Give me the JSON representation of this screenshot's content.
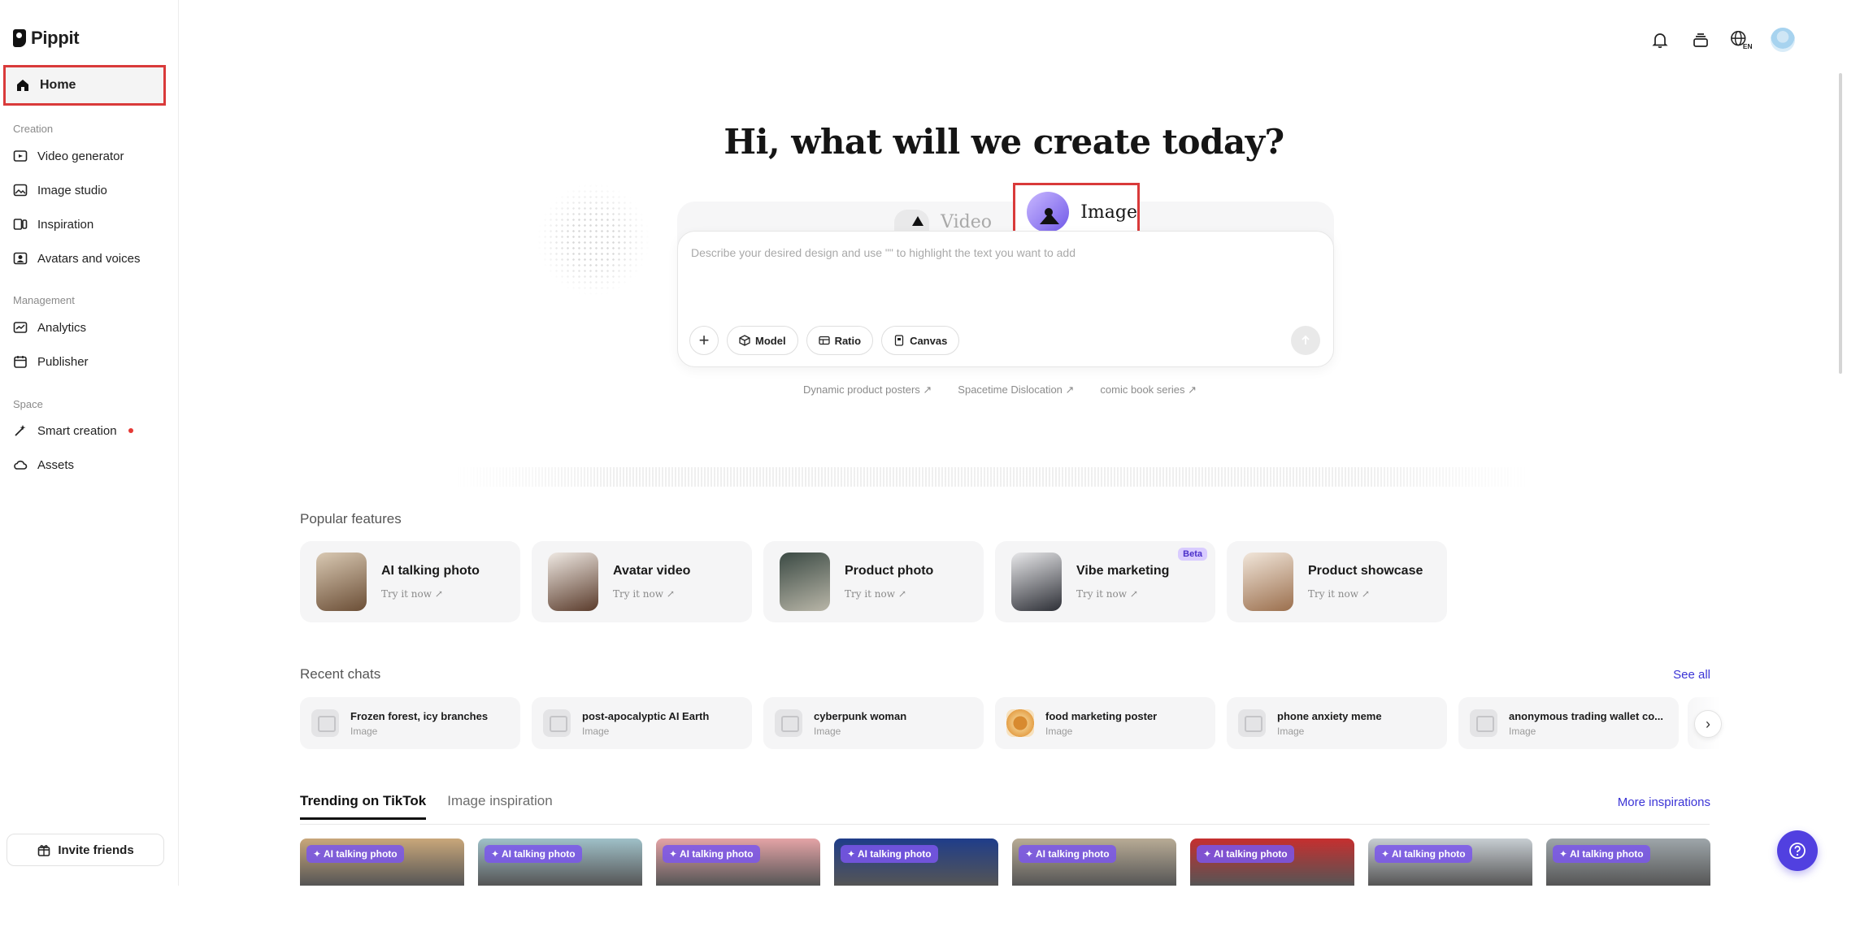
{
  "app": {
    "logo_text": "Pippit"
  },
  "sidebar": {
    "home_label": "Home",
    "sections": {
      "creation": "Creation",
      "management": "Management",
      "space": "Space"
    },
    "creation_items": [
      {
        "label": "Video generator",
        "icon": "video-plus-icon"
      },
      {
        "label": "Image studio",
        "icon": "image-plus-icon"
      },
      {
        "label": "Inspiration",
        "icon": "inspiration-icon"
      },
      {
        "label": "Avatars and voices",
        "icon": "avatar-icon"
      }
    ],
    "management_items": [
      {
        "label": "Analytics",
        "icon": "analytics-icon"
      },
      {
        "label": "Publisher",
        "icon": "calendar-icon"
      }
    ],
    "space_items": [
      {
        "label": "Smart creation",
        "icon": "magic-wand-icon",
        "has_dot": true
      },
      {
        "label": "Assets",
        "icon": "cloud-icon"
      }
    ],
    "invite_label": "Invite friends"
  },
  "topbar": {
    "icons": [
      "bell-icon",
      "stack-icon",
      "globe-language-icon",
      "user-avatar"
    ],
    "language_badge": "EN"
  },
  "hero": {
    "title": "Hi, what will we create today?",
    "tabs": {
      "video": "Video",
      "image": "Image"
    },
    "placeholder": "Describe your desired design and use \"\" to highlight the text you want to add",
    "tools": {
      "model": "Model",
      "ratio": "Ratio",
      "canvas": "Canvas"
    },
    "suggestions": [
      "Dynamic product posters ↗",
      "Spacetime Dislocation ↗",
      "comic book series ↗"
    ]
  },
  "popular": {
    "title": "Popular features",
    "try_label": "Try it now ↗",
    "beta_label": "Beta",
    "items": [
      {
        "title": "AI talking photo"
      },
      {
        "title": "Avatar video"
      },
      {
        "title": "Product photo"
      },
      {
        "title": "Vibe marketing"
      },
      {
        "title": "Product showcase"
      }
    ]
  },
  "recent": {
    "title": "Recent chats",
    "see_all": "See all",
    "items": [
      {
        "title": "Frozen forest, icy branches",
        "type": "Image"
      },
      {
        "title": "post-apocalyptic AI Earth",
        "type": "Image"
      },
      {
        "title": "cyberpunk woman",
        "type": "Image"
      },
      {
        "title": "food marketing poster",
        "type": "Image"
      },
      {
        "title": "phone anxiety meme",
        "type": "Image"
      },
      {
        "title": "anonymous trading wallet co...",
        "type": "Image"
      }
    ]
  },
  "trending": {
    "tab_active": "Trending on TikTok",
    "tab_inactive": "Image inspiration",
    "more": "More inspirations",
    "badge": "AI talking photo",
    "thumb_colors": [
      "#c9a77a",
      "#9fc0c8",
      "#e4a3a6",
      "#1f3d8a",
      "#b8ab95",
      "#c62f2f",
      "#c7cdd2",
      "#9ea6aa"
    ]
  },
  "colors": {
    "accent": "#5140e0",
    "highlight_box": "#d93a3a",
    "link": "#3b34d6"
  }
}
